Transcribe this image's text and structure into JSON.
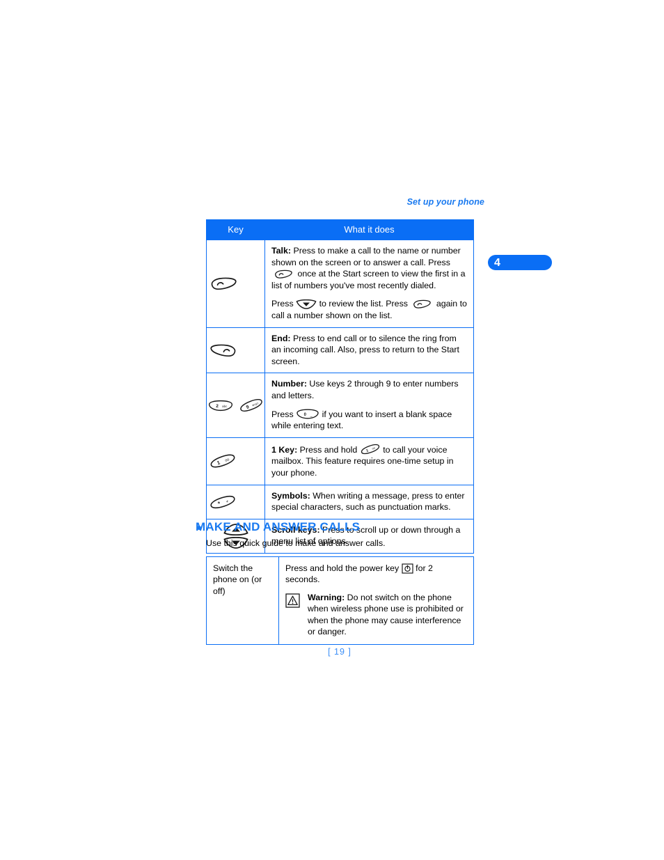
{
  "document": {
    "running_head": "Set up your phone",
    "chapter_tab_number": "4",
    "page_number": "[ 19 ]",
    "accent_color": "#0a6ef5",
    "heading_color": "#1a7af0"
  },
  "key_table": {
    "headers": [
      "Key",
      "What it does"
    ],
    "rows": [
      {
        "key_icons": [
          "talk-key"
        ],
        "paragraphs": [
          {
            "lead": "Talk:",
            "parts": [
              {
                "type": "text",
                "value": " Press to make a call to the name or number shown on the screen or to answer a call. Press "
              },
              {
                "type": "icon",
                "value": "talk-key"
              },
              {
                "type": "text",
                "value": " once at the Start screen to view the first in a list of numbers you've most recently dialed."
              }
            ]
          },
          {
            "lead": "",
            "parts": [
              {
                "type": "text",
                "value": "Press "
              },
              {
                "type": "icon",
                "value": "scroll-down-key"
              },
              {
                "type": "text",
                "value": " to review the list. Press "
              },
              {
                "type": "icon",
                "value": "talk-key"
              },
              {
                "type": "text",
                "value": " again to call a number shown on the list."
              }
            ]
          }
        ]
      },
      {
        "key_icons": [
          "end-key"
        ],
        "paragraphs": [
          {
            "lead": "End:",
            "parts": [
              {
                "type": "text",
                "value": " Press to end call or to silence the ring from an incoming call. Also, press to return to the Start screen."
              }
            ]
          }
        ]
      },
      {
        "key_icons": [
          "number-key-2",
          "number-key-9"
        ],
        "paragraphs": [
          {
            "lead": "Number:",
            "parts": [
              {
                "type": "text",
                "value": " Use keys 2 through 9 to enter numbers and letters."
              }
            ]
          },
          {
            "lead": "",
            "parts": [
              {
                "type": "text",
                "value": "Press "
              },
              {
                "type": "icon",
                "value": "number-key-0"
              },
              {
                "type": "text",
                "value": " if you want to insert a blank space while entering text."
              }
            ]
          }
        ]
      },
      {
        "key_icons": [
          "number-key-1"
        ],
        "paragraphs": [
          {
            "lead": "1 Key:",
            "parts": [
              {
                "type": "text",
                "value": " Press and hold "
              },
              {
                "type": "icon",
                "value": "number-key-1"
              },
              {
                "type": "text",
                "value": " to call your voice mailbox. This feature requires one-time setup in your phone."
              }
            ]
          }
        ]
      },
      {
        "key_icons": [
          "star-key"
        ],
        "paragraphs": [
          {
            "lead": "Symbols:",
            "parts": [
              {
                "type": "text",
                "value": " When writing a message, press to enter special characters, such as punctuation marks."
              }
            ]
          }
        ]
      },
      {
        "key_icons": [
          "scroll-up-key",
          "scroll-down-key"
        ],
        "paragraphs": [
          {
            "lead": "Scroll keys:",
            "parts": [
              {
                "type": "text",
                "value": " Press to scroll up or down through a menu list of options."
              }
            ]
          }
        ]
      }
    ]
  },
  "section": {
    "bullet": "•",
    "title": "MAKE AND ANSWER CALLS",
    "intro": "Use this quick guide to make and answer calls."
  },
  "calls_table": {
    "rows": [
      {
        "label": "Switch the phone on (or off)",
        "instruction_pre": "Press and hold the power key ",
        "instruction_icon": "power-key",
        "instruction_post": " for 2 seconds.",
        "warning_lead": "Warning:",
        "warning_text": " Do not switch on the phone when wireless phone use is prohibited or when the phone may cause interference or danger.",
        "warning_icon": "warning-triangle-icon"
      }
    ]
  },
  "key_glyph_labels": {
    "number-key-2": {
      "digit": "2",
      "letters": "abc"
    },
    "number-key-9": {
      "digit": "9",
      "letters": "wxyz"
    },
    "number-key-1": {
      "digit": "1",
      "letters": "∞"
    },
    "number-key-0": {
      "digit": "0",
      "letters": "—"
    },
    "star-key": {
      "digit": "*",
      "letters": "+"
    },
    "power-key": {
      "symbol": "Φ"
    }
  }
}
